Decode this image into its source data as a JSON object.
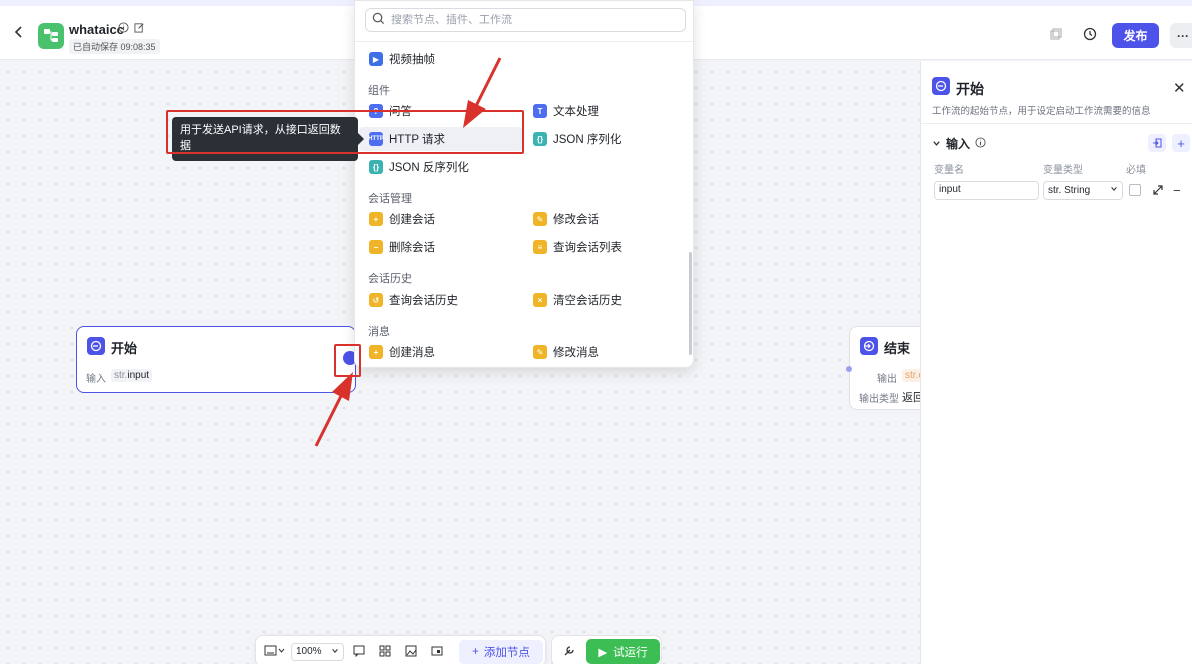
{
  "header": {
    "app_name": "whataicc",
    "save_status": "已自动保存 09:08:35",
    "publish_label": "发布",
    "more_label": "···"
  },
  "node_panel": {
    "search_placeholder": "搜索节点、插件、工作流",
    "top_items": [
      {
        "label": "视频抽帧",
        "icon": "video-icon"
      }
    ],
    "sections": [
      {
        "title": "组件",
        "items": [
          {
            "label": "问答",
            "icon": "qa-icon"
          },
          {
            "label": "文本处理",
            "icon": "text-icon"
          },
          {
            "label": "HTTP 请求",
            "icon": "http-icon"
          },
          {
            "label": "JSON 序列化",
            "icon": "json-icon"
          },
          {
            "label": "JSON 反序列化",
            "icon": "json-icon"
          }
        ]
      },
      {
        "title": "会话管理",
        "items": [
          {
            "label": "创建会话",
            "icon": "chat-icon"
          },
          {
            "label": "修改会话",
            "icon": "chat-icon"
          },
          {
            "label": "删除会话",
            "icon": "chat-icon"
          },
          {
            "label": "查询会话列表",
            "icon": "chat-icon"
          }
        ]
      },
      {
        "title": "会话历史",
        "items": [
          {
            "label": "查询会话历史",
            "icon": "history-icon"
          },
          {
            "label": "清空会话历史",
            "icon": "history-icon"
          }
        ]
      },
      {
        "title": "消息",
        "items": [
          {
            "label": "创建消息",
            "icon": "message-icon"
          },
          {
            "label": "修改消息",
            "icon": "message-icon"
          }
        ]
      }
    ]
  },
  "tooltip": {
    "text": "用于发送API请求，从接口返回数据"
  },
  "start_node": {
    "title": "开始",
    "input_label": "输入",
    "input_type_prefix": "str.",
    "input_name": "input"
  },
  "end_node": {
    "title": "结束",
    "output_label": "输出",
    "output_tag": "str.o",
    "output_type_label": "输出类型",
    "output_type_value": "返回"
  },
  "right_panel": {
    "title": "开始",
    "description": "工作流的起始节点，用于设定启动工作流需要的信息",
    "section_title": "输入",
    "col_var_name": "变量名",
    "col_var_type": "变量类型",
    "col_required": "必填",
    "var_name_value": "input",
    "var_type_value": "str. String"
  },
  "toolbar": {
    "zoom": "100%",
    "add_node_label": "添加节点",
    "run_label": "试运行"
  },
  "colors": {
    "primary": "#4d53e8",
    "run_green": "#3dbe55",
    "annotation_red": "#d9312b"
  }
}
